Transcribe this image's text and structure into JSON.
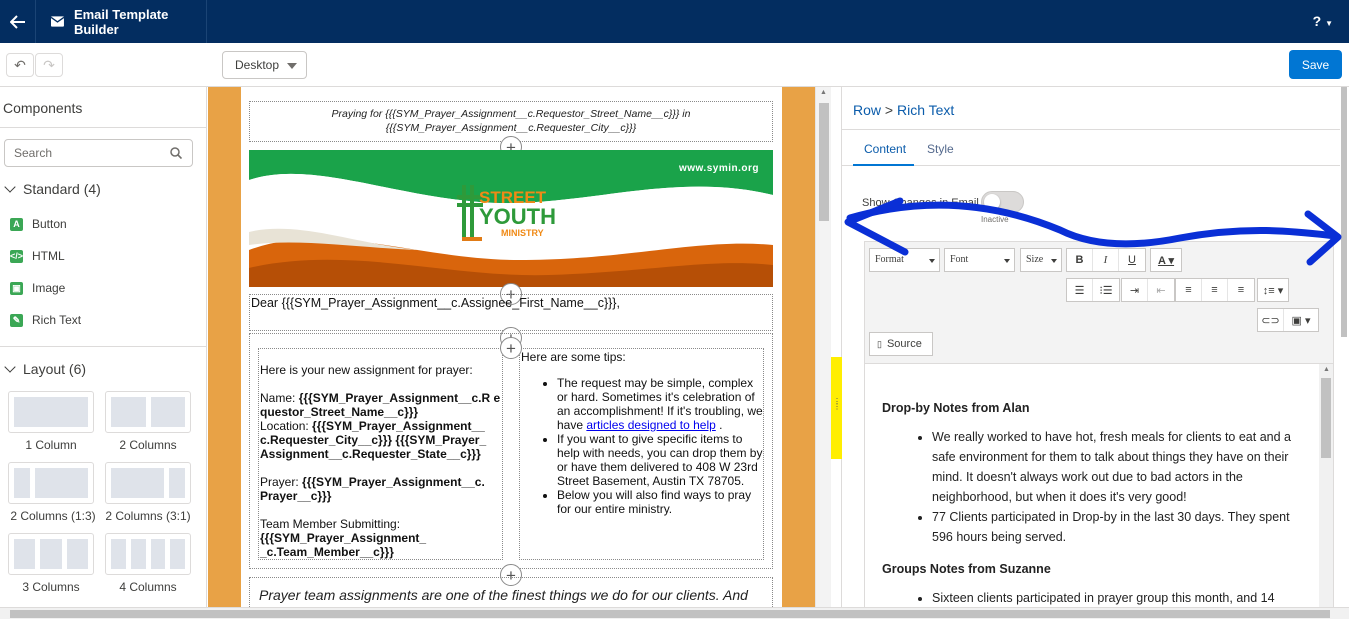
{
  "header": {
    "title": "Email Template Builder",
    "help_label": "?"
  },
  "toolbar": {
    "device": "Desktop",
    "save_label": "Save"
  },
  "components": {
    "heading": "Components",
    "search_placeholder": "Search",
    "standard": {
      "label": "Standard (4)",
      "items": [
        "Button",
        "HTML",
        "Image",
        "Rich Text"
      ]
    },
    "layout": {
      "label": "Layout (6)",
      "items": [
        "1 Column",
        "2 Columns",
        "2 Columns (1:3)",
        "2 Columns (3:1)",
        "3 Columns",
        "4 Columns"
      ]
    }
  },
  "email": {
    "preheader_line1": "Praying for {{{SYM_Prayer_Assignment__c.Requestor_Street_Name__c}}} in",
    "preheader_line2": "{{{SYM_Prayer_Assignment__c.Requester_City__c}}}",
    "banner_url": "www.symin.org",
    "logo_line1": "STREET",
    "logo_line2": "YOUTH",
    "logo_line3": "MINISTRY",
    "greeting": "Dear {{{SYM_Prayer_Assignment__c.Assignee_First_Name__c}}},",
    "left_col": {
      "intro": "Here is your new assignment for prayer:",
      "name_label": "Name:",
      "name_value": "{{{SYM_Prayer_Assignment__c.R equestor_Street_Name__c}}}",
      "location_label": "Location:",
      "location_value": "{{{SYM_Prayer_Assignment__ c.Requester_City__c}}} {{{SYM_Prayer_ Assignment__c.Requester_State__c}}}",
      "prayer_label": "Prayer:",
      "prayer_value": "{{{SYM_Prayer_Assignment__c. Prayer__c}}}",
      "team_label": "Team Member Submitting:",
      "team_value": "{{{SYM_Prayer_Assignment_ _c.Team_Member__c}}}"
    },
    "right_col": {
      "intro": "Here are some tips:",
      "tip1": "The request may be simple, complex or hard. Sometimes it's celebration of an accomplishment! If it's troubling, we have",
      "tip1_link": "articles designed to help",
      "tip1_end": ".",
      "tip2": "If you want to give specific items to help with needs, you can drop them by or have them delivered to 408 W 23rd Street Basement, Austin TX 78705.",
      "tip3": "Below you will also find ways to pray for our entire ministry."
    },
    "footer_text": "Prayer team assignments are one of the finest things we do for our clients. And"
  },
  "properties": {
    "breadcrumb_row": "Row",
    "breadcrumb_sep": ">",
    "breadcrumb_current": "Rich Text",
    "tabs": [
      "Content",
      "Style"
    ],
    "show_changes_label": "Show Changes in Email",
    "toggle_state": "Inactive",
    "editor": {
      "format_label": "Format",
      "font_label": "Font",
      "size_label": "Size",
      "source_label": "Source",
      "section1_title": "Drop-by Notes from Alan",
      "section1_items": [
        "We really worked to have hot, fresh meals for clients to eat and a safe environment for them to talk about things they have on their mind. It doesn't always work out due to bad actors in the neighborhood, but when it does it's very good!",
        "77 Clients participated in Drop-by in the last 30 days. They spent 596 hours being served."
      ],
      "section2_title": "Groups Notes from Suzanne",
      "section2_items": [
        "Sixteen clients participated in prayer group this month, and 14"
      ]
    }
  },
  "colors": {
    "header_bg": "#032d60",
    "brand_blue": "#0176d3",
    "canvas_bg": "#e8a246",
    "handle_yellow": "#ffee02",
    "annotation_blue": "#0a2fd6",
    "banner_green": "#1aa34a",
    "banner_orange": "#d9650c"
  }
}
